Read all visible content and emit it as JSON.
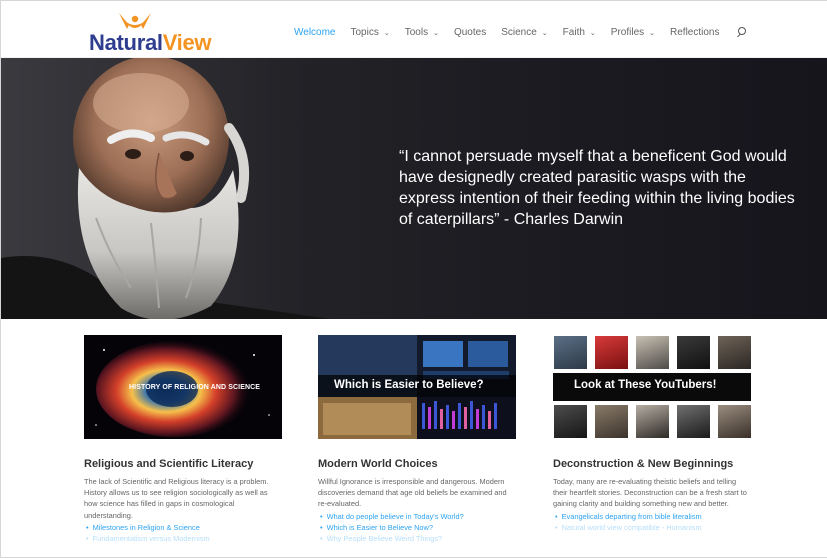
{
  "logo": {
    "part1": "Natural",
    "part2": "View"
  },
  "nav": {
    "items": [
      {
        "label": "Welcome",
        "active": true,
        "has_menu": false
      },
      {
        "label": "Topics",
        "active": false,
        "has_menu": true
      },
      {
        "label": "Tools",
        "active": false,
        "has_menu": true
      },
      {
        "label": "Quotes",
        "active": false,
        "has_menu": false
      },
      {
        "label": "Science",
        "active": false,
        "has_menu": true
      },
      {
        "label": "Faith",
        "active": false,
        "has_menu": true
      },
      {
        "label": "Profiles",
        "active": false,
        "has_menu": true
      },
      {
        "label": "Reflections",
        "active": false,
        "has_menu": false
      }
    ],
    "caret": "⌄",
    "search_icon": "search-icon"
  },
  "hero": {
    "quote": "“I cannot persuade myself that a beneficent God would have designedly created parasitic wasps with the express intention of their feeding within the living bodies of caterpillars” - Charles Darwin"
  },
  "cards": [
    {
      "image_label": "HISTORY OF RELIGION AND SCIENCE",
      "title": "Religious and Scientific Literacy",
      "text": "The lack of Scientific and Religious literacy is a problem. History allows us to see religion sociologically as well as how science has filled in gaps in cosmological understanding.",
      "links": [
        "Milestones in Religion & Science",
        "Fundamentalism versus Modernism"
      ]
    },
    {
      "image_label": "Which is Easier to Believe?",
      "title": "Modern World Choices",
      "text": "Willful Ignorance is irresponsible and dangerous. Modern discoveries demand that age old beliefs be examined and re-evaluated.",
      "links": [
        "What do people believe in Today's World?",
        "Which is Easier to Believe Now?",
        "Why People Believe Weird Things?"
      ]
    },
    {
      "image_label": "Look at These YouTubers!",
      "title": "Deconstruction & New Beginnings",
      "text": "Today, many are re-evaluating theistic beliefs and telling their heartfelt stories. Deconstruction can be a fresh start to gaining clarity and building something new and better.",
      "links": [
        "Evangelicals departing from bible literalism",
        "Natural world view compatible - Humanism"
      ]
    }
  ],
  "colors": {
    "accent": "#2ea3f2",
    "logo_blue": "#2e3d8f",
    "logo_orange": "#f39322",
    "hero_bg": "#1c1c22"
  }
}
